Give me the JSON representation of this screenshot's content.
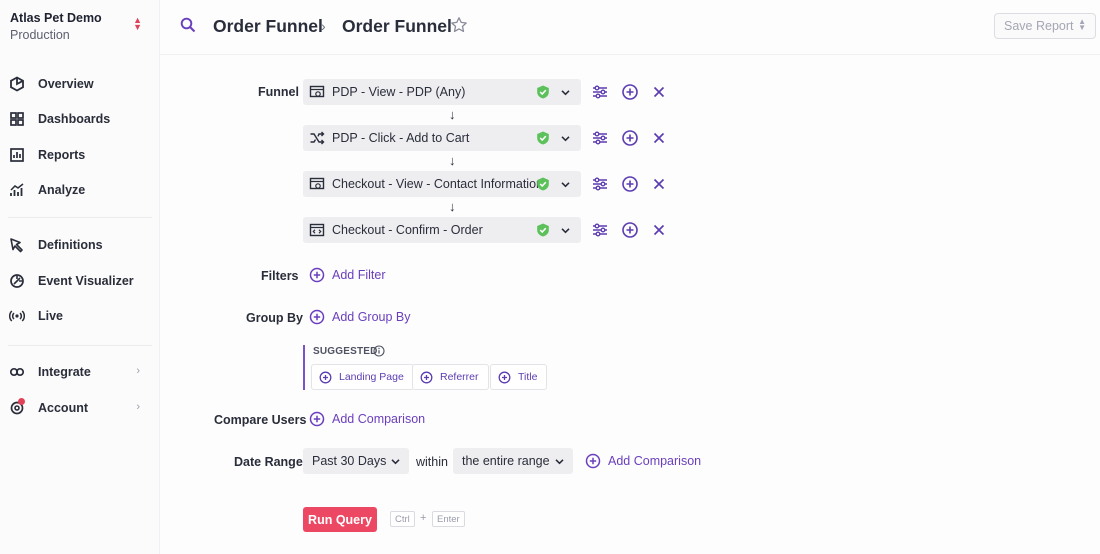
{
  "sidebar": {
    "org_name": "Atlas Pet Demo",
    "org_env": "Production",
    "items": [
      {
        "label": "Overview",
        "icon": "hexagon-icon"
      },
      {
        "label": "Dashboards",
        "icon": "grid-icon"
      },
      {
        "label": "Reports",
        "icon": "report-icon"
      },
      {
        "label": "Analyze",
        "icon": "analyze-chart-icon"
      },
      {
        "label": "Definitions",
        "icon": "definitions-cursor-icon"
      },
      {
        "label": "Event Visualizer",
        "icon": "event-visualizer-icon"
      },
      {
        "label": "Live",
        "icon": "live-broadcast-icon"
      },
      {
        "label": "Integrate",
        "icon": "integrate-link-icon"
      },
      {
        "label": "Account",
        "icon": "account-gear-icon"
      }
    ]
  },
  "header": {
    "crumb_1": "Order Funnel",
    "crumb_2": "Order Funnel",
    "save_label": "Save Report"
  },
  "funnel": {
    "label": "Funnel",
    "steps": [
      {
        "label": "PDP - View - PDP (Any)",
        "icon": "page-view-icon"
      },
      {
        "label": "PDP - Click - Add to Cart",
        "icon": "click-icon"
      },
      {
        "label": "Checkout - View - Contact Information",
        "icon": "page-view-icon"
      },
      {
        "label": "Checkout - Confirm - Order",
        "icon": "confirm-code-icon"
      }
    ]
  },
  "filters": {
    "label": "Filters",
    "add_label": "Add Filter"
  },
  "group_by": {
    "label": "Group By",
    "add_label": "Add Group By",
    "suggested_title": "SUGGESTED",
    "suggestions": [
      "Landing Page",
      "Referrer",
      "Title"
    ]
  },
  "compare": {
    "label": "Compare Users",
    "add_label": "Add Comparison"
  },
  "date_range": {
    "label": "Date Range",
    "range_value": "Past 30 Days",
    "within_label": "within",
    "within_value": "the entire range",
    "add_label": "Add Comparison"
  },
  "run": {
    "label": "Run Query",
    "key_1": "Ctrl",
    "key_plus": "+",
    "key_2": "Enter"
  },
  "colors": {
    "accent": "#6a3fbd",
    "run": "#ec4863",
    "check": "#5cc15a"
  }
}
